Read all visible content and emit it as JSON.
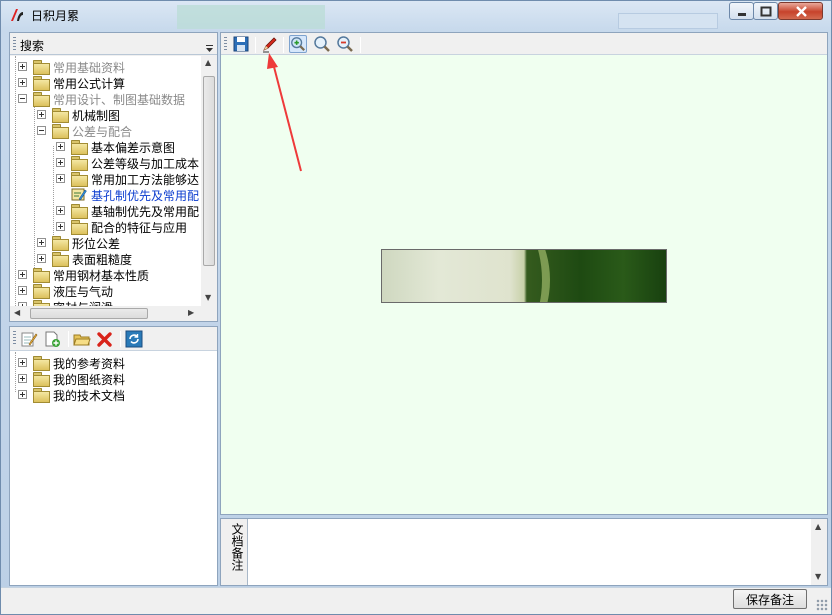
{
  "window": {
    "title": "日积月累"
  },
  "search": {
    "label": "搜索"
  },
  "tree": {
    "nodes": [
      {
        "label": "常用基础资料",
        "state": "dim"
      },
      {
        "label": "常用公式计算",
        "state": "normal"
      },
      {
        "label": "常用设计、制图基础数据",
        "state": "dim"
      },
      {
        "label": "机械制图",
        "state": "normal"
      },
      {
        "label": "公差与配合",
        "state": "dim"
      },
      {
        "label": "基本偏差示意图",
        "state": "normal"
      },
      {
        "label": "公差等级与加工成本",
        "state": "normal"
      },
      {
        "label": "常用加工方法能够达",
        "state": "normal"
      },
      {
        "label": "基孔制优先及常用配",
        "state": "selected"
      },
      {
        "label": "基轴制优先及常用配",
        "state": "normal"
      },
      {
        "label": "配合的特征与应用",
        "state": "normal"
      },
      {
        "label": "形位公差",
        "state": "normal"
      },
      {
        "label": "表面粗糙度",
        "state": "normal"
      },
      {
        "label": "常用钢材基本性质",
        "state": "normal"
      },
      {
        "label": "液压与气动",
        "state": "normal"
      },
      {
        "label": "密封与润滑",
        "state": "normal"
      }
    ]
  },
  "docs_tree": {
    "nodes": [
      {
        "label": "我的参考资料"
      },
      {
        "label": "我的图纸资料"
      },
      {
        "label": "我的技术文档"
      }
    ]
  },
  "left_toolbar": {
    "icons": [
      "edit-note-icon",
      "new-document-icon",
      "open-folder-icon",
      "delete-icon",
      "refresh-icon"
    ]
  },
  "viewer_toolbar": {
    "icons": [
      "save-icon",
      "pen-icon",
      "zoom-in-icon",
      "zoom-fit-icon",
      "zoom-out-icon"
    ]
  },
  "notes": {
    "label": "文档备注",
    "value": ""
  },
  "status": {
    "save_label": "保存备注"
  },
  "colors": {
    "viewer_bg": "#f0fff0",
    "selected_text": "#0b3ccf",
    "dim_text": "#8a8a8a",
    "annotation_arrow": "#ee3a3a"
  }
}
